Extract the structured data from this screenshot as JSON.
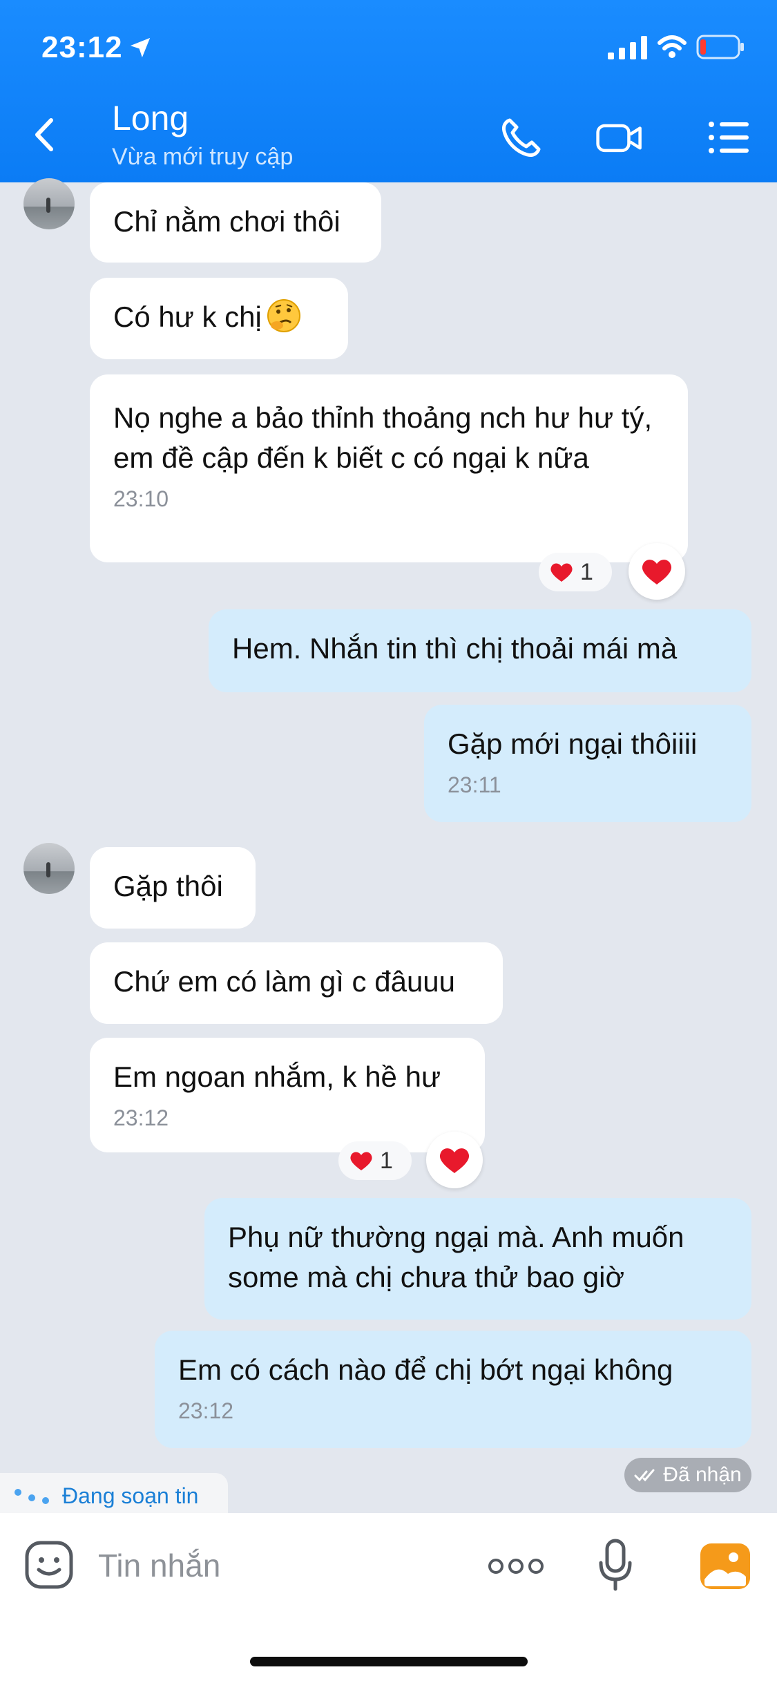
{
  "status_bar": {
    "time": "23:12"
  },
  "header": {
    "contact_name": "Long",
    "contact_status": "Vừa mới truy cập"
  },
  "messages": [
    {
      "side": "in",
      "text": "Chỉ nằm chơi thôi"
    },
    {
      "side": "in",
      "text": "Có hư k chị"
    },
    {
      "side": "in",
      "text": "Nọ nghe a bảo thỉnh thoảng nch hư hư tý, em đề cập đến k biết c có ngại k nữa",
      "time": "23:10",
      "reaction_count": "1"
    },
    {
      "side": "out",
      "text": "Hem. Nhắn tin thì chị thoải mái mà"
    },
    {
      "side": "out",
      "text": "Gặp mới ngại thôiiii",
      "time": "23:11"
    },
    {
      "side": "in",
      "text": "Gặp thôi"
    },
    {
      "side": "in",
      "text": "Chứ em có làm gì c đâuuu"
    },
    {
      "side": "in",
      "text": "Em ngoan nhắm, k hề hư",
      "time": "23:12",
      "reaction_count": "1"
    },
    {
      "side": "out",
      "text": "Phụ nữ thường ngại mà. Anh muốn some mà chị chưa thử bao giờ"
    },
    {
      "side": "out",
      "text": "Em có cách nào để chị bớt ngại không",
      "time": "23:12"
    }
  ],
  "received_label": "Đã nhận",
  "typing_label": "Đang soạn tin",
  "input": {
    "placeholder": "Tin nhắn"
  },
  "colors": {
    "header": "#0b7cf5",
    "outgoing_bubble": "#d4ecfc",
    "incoming_bubble": "#ffffff",
    "heart": "#e8192c"
  },
  "icons": [
    "back-icon",
    "phone-icon",
    "video-call-icon",
    "menu-icon",
    "sticker-icon",
    "more-icon",
    "mic-icon",
    "image-icon"
  ]
}
